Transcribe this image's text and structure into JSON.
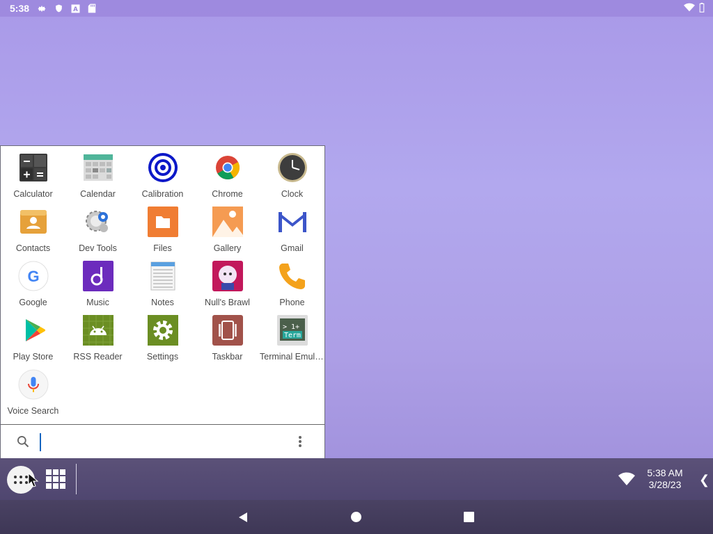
{
  "status_bar": {
    "time": "5:38",
    "icons": [
      "gear-icon",
      "shield-icon",
      "a-letter-icon",
      "sdcard-icon"
    ],
    "right_icons": [
      "wifi-icon",
      "battery-icon"
    ]
  },
  "drawer": {
    "apps": [
      {
        "label": "Calculator",
        "icon": "calculator-icon"
      },
      {
        "label": "Calendar",
        "icon": "calendar-icon"
      },
      {
        "label": "Calibration",
        "icon": "calibration-icon"
      },
      {
        "label": "Chrome",
        "icon": "chrome-icon"
      },
      {
        "label": "Clock",
        "icon": "clock-icon"
      },
      {
        "label": "Contacts",
        "icon": "contacts-icon"
      },
      {
        "label": "Dev Tools",
        "icon": "dev-tools-icon"
      },
      {
        "label": "Files",
        "icon": "files-icon"
      },
      {
        "label": "Gallery",
        "icon": "gallery-icon"
      },
      {
        "label": "Gmail",
        "icon": "gmail-icon"
      },
      {
        "label": "Google",
        "icon": "google-icon"
      },
      {
        "label": "Music",
        "icon": "music-icon"
      },
      {
        "label": "Notes",
        "icon": "notes-icon"
      },
      {
        "label": "Null's Brawl",
        "icon": "nulls-brawl-icon"
      },
      {
        "label": "Phone",
        "icon": "phone-icon"
      },
      {
        "label": "Play Store",
        "icon": "play-store-icon"
      },
      {
        "label": "RSS Reader",
        "icon": "rss-reader-icon"
      },
      {
        "label": "Settings",
        "icon": "settings-icon"
      },
      {
        "label": "Taskbar",
        "icon": "taskbar-icon"
      },
      {
        "label": "Terminal Emulator",
        "icon": "terminal-icon"
      },
      {
        "label": "Voice Search",
        "icon": "voice-search-icon"
      }
    ],
    "search": {
      "placeholder": "",
      "value": ""
    }
  },
  "taskbar": {
    "clock_time": "5:38 AM",
    "clock_date": "3/28/23"
  },
  "colors": {
    "wallpaper": "#ad9fe6",
    "taskbar": "#544a74",
    "accent": "#1565c0"
  }
}
